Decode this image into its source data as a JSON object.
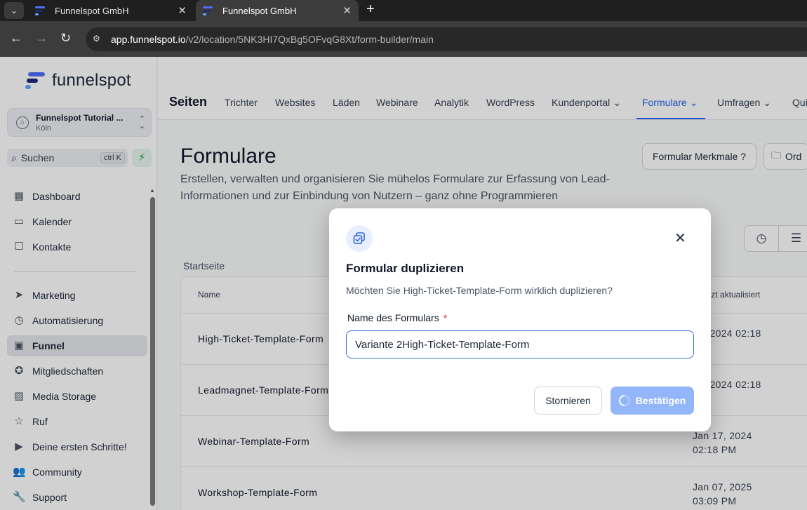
{
  "browser": {
    "tabs": [
      {
        "title": "Funnelspot GmbH"
      },
      {
        "title": "Funnelspot GmbH"
      }
    ],
    "url_host": "app.funnelspot.io",
    "url_path": "/v2/location/5NK3HI7QxBg5OFvqG8Xt/form-builder/main"
  },
  "brand": {
    "name": "funnelspot",
    "colors": {
      "blue": "#4f6ef7",
      "navy": "#1e2a78",
      "sky": "#60a5fa"
    }
  },
  "location": {
    "name": "Funnelspot Tutorial ...",
    "city": "Köln"
  },
  "search": {
    "label": "Suchen",
    "shortcut": "ctrl K"
  },
  "sidebar": {
    "items": [
      {
        "label": "Dashboard",
        "icon": "grid-icon"
      },
      {
        "label": "Kalender",
        "icon": "calendar-icon"
      },
      {
        "label": "Kontakte",
        "icon": "contacts-icon"
      },
      {
        "label": "Marketing",
        "icon": "send-icon"
      },
      {
        "label": "Automatisierung",
        "icon": "automation-icon"
      },
      {
        "label": "Funnel",
        "icon": "funnel-icon"
      },
      {
        "label": "Mitgliedschaften",
        "icon": "award-icon"
      },
      {
        "label": "Media Storage",
        "icon": "image-icon"
      },
      {
        "label": "Ruf",
        "icon": "star-icon"
      },
      {
        "label": "Deine ersten Schritte!",
        "icon": "play-icon"
      },
      {
        "label": "Community",
        "icon": "users-icon"
      },
      {
        "label": "Support",
        "icon": "wrench-icon"
      }
    ]
  },
  "topnav": {
    "section": "Seiten",
    "links": [
      "Trichter",
      "Websites",
      "Läden",
      "Webinare",
      "Analytik",
      "WordPress",
      "Kundenportal",
      "Formulare",
      "Umfragen",
      "Qui"
    ]
  },
  "page": {
    "title": "Formulare",
    "description": "Erstellen, verwalten und organisieren Sie mühelos Formulare zur Erfassung von Lead-Informationen und zur Einbindung von Nutzern – ganz ohne Programmieren",
    "btn_features": "Formular Merkmale ?",
    "btn_folder": "Ord",
    "breadcrumb": "Startseite"
  },
  "table": {
    "headers": {
      "name": "Name",
      "updated": "tzt aktualisiert"
    },
    "rows": [
      {
        "name": "High-Ticket-Template-Form",
        "date": "17, 2024 02:18"
      },
      {
        "name": "Leadmagnet-Template-Form",
        "date": "17, 2024 02:18"
      },
      {
        "name": "Webinar-Template-Form",
        "date": "Jan 17, 2024 02:18 PM"
      },
      {
        "name": "Workshop-Template-Form",
        "date": "Jan 07, 2025 03:09 PM"
      }
    ]
  },
  "modal": {
    "title": "Formular duplizieren",
    "text": "Möchten Sie High-Ticket-Template-Form wirklich duplizieren?",
    "field_label": "Name des Formulars",
    "required_mark": "*",
    "field_value": "Variante 2High-Ticket-Template-Form",
    "cancel": "Stornieren",
    "confirm": "Bestätigen"
  }
}
